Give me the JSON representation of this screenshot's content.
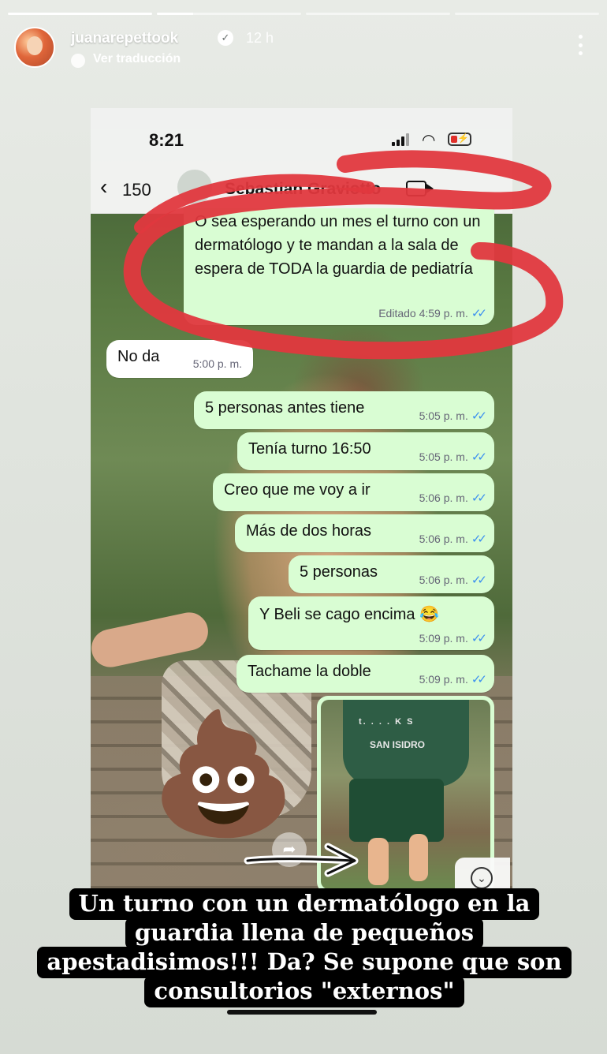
{
  "story": {
    "progress": [
      1.0,
      0.25,
      0.0,
      0.0
    ],
    "username": "juanarepettook",
    "time_ago": "12 h",
    "translate_label": "Ver traducción",
    "verified_glyph": "✓",
    "caption": "Un turno con un dermatólogo en la guardia llena de pequeños apestadisimos!!! Da? Se supone que son consultorios \"externos\""
  },
  "phone": {
    "clock": "8:21",
    "back_count": "150",
    "contact_name": "Sebastian Graviotto"
  },
  "messages": [
    {
      "dir": "out",
      "text": "O sea esperando un mes el turno con un dermatólogo y te mandan a la sala de espera de TODA la guardia de pediatría",
      "time": "Editado 4:59 p. m."
    },
    {
      "dir": "in",
      "text": "No da",
      "time": "5:00 p. m."
    },
    {
      "dir": "out",
      "text": "5 personas antes tiene",
      "time": "5:05 p. m."
    },
    {
      "dir": "out",
      "text": "Tenía turno 16:50",
      "time": "5:05 p. m."
    },
    {
      "dir": "out",
      "text": "Creo que me voy a ir",
      "time": "5:06 p. m."
    },
    {
      "dir": "out",
      "text": "Más de dos horas",
      "time": "5:06 p. m."
    },
    {
      "dir": "out",
      "text": "5 personas",
      "time": "5:06 p. m."
    },
    {
      "dir": "out",
      "text": "Y Beli se cago encima 😂",
      "time": "5:09 p. m."
    },
    {
      "dir": "out",
      "text": "Tachame la doble",
      "time": "5:09 p. m."
    }
  ],
  "photo_message": {
    "hoodie_text": "SAN ISIDRO",
    "hoodie_top": "t. . . . K S"
  },
  "icons": {
    "poop": "💩",
    "ticks": "✓✓",
    "chevron_down": "⌄",
    "forward": "➦"
  },
  "colors": {
    "bubble_out": "#d9fdd3",
    "bubble_in": "#ffffff",
    "tick": "#3a8ff0",
    "marker": "#e0383e"
  }
}
